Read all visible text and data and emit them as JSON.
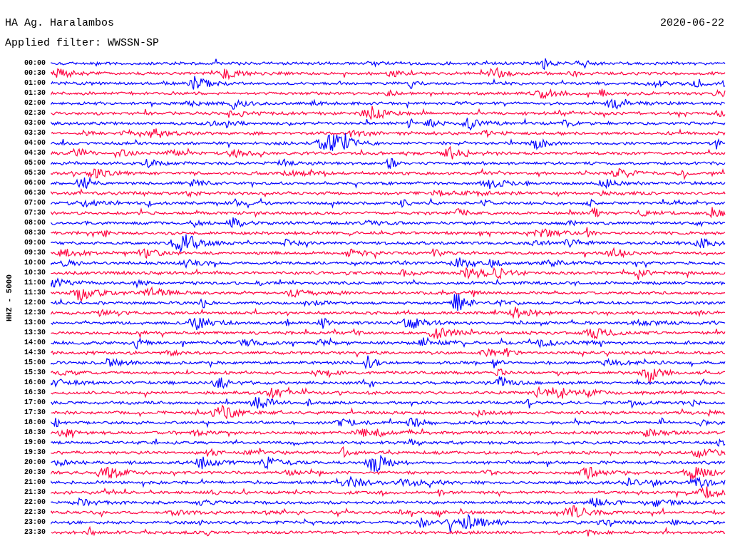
{
  "station": "HA Ag. Haralambos",
  "date": "2020-06-22",
  "filter": "Applied filter: WWSSN-SP",
  "axis_label": "HHZ - 5000",
  "traces": [
    {
      "time": "00:00",
      "color": "#0000ff"
    },
    {
      "time": "00:30",
      "color": "#ff0040"
    },
    {
      "time": "01:00",
      "color": "#0000ff"
    },
    {
      "time": "01:30",
      "color": "#ff0040"
    },
    {
      "time": "02:00",
      "color": "#0000ff"
    },
    {
      "time": "02:30",
      "color": "#ff0040"
    },
    {
      "time": "03:00",
      "color": "#0000ff"
    },
    {
      "time": "03:30",
      "color": "#ff0040"
    },
    {
      "time": "04:00",
      "color": "#0000ff"
    },
    {
      "time": "04:30",
      "color": "#ff0040"
    },
    {
      "time": "05:00",
      "color": "#0000ff"
    },
    {
      "time": "05:30",
      "color": "#ff0040"
    },
    {
      "time": "06:00",
      "color": "#0000ff"
    },
    {
      "time": "06:30",
      "color": "#ff0040"
    },
    {
      "time": "07:00",
      "color": "#0000ff"
    },
    {
      "time": "07:30",
      "color": "#ff0040"
    },
    {
      "time": "08:00",
      "color": "#0000ff"
    },
    {
      "time": "08:30",
      "color": "#ff0040"
    },
    {
      "time": "09:00",
      "color": "#0000ff"
    },
    {
      "time": "09:30",
      "color": "#ff0040"
    },
    {
      "time": "10:00",
      "color": "#0000ff"
    },
    {
      "time": "10:30",
      "color": "#ff0040"
    },
    {
      "time": "11:00",
      "color": "#0000ff"
    },
    {
      "time": "11:30",
      "color": "#ff0040"
    },
    {
      "time": "12:00",
      "color": "#0000ff"
    },
    {
      "time": "12:30",
      "color": "#ff0040"
    },
    {
      "time": "13:00",
      "color": "#0000ff"
    },
    {
      "time": "13:30",
      "color": "#ff0040"
    },
    {
      "time": "14:00",
      "color": "#0000ff"
    },
    {
      "time": "14:30",
      "color": "#ff0040"
    },
    {
      "time": "15:00",
      "color": "#0000ff"
    },
    {
      "time": "15:30",
      "color": "#ff0040"
    },
    {
      "time": "16:00",
      "color": "#0000ff"
    },
    {
      "time": "16:30",
      "color": "#ff0040"
    },
    {
      "time": "17:00",
      "color": "#0000ff"
    },
    {
      "time": "17:30",
      "color": "#ff0040"
    },
    {
      "time": "18:00",
      "color": "#0000ff"
    },
    {
      "time": "18:30",
      "color": "#ff0040"
    },
    {
      "time": "19:00",
      "color": "#0000ff"
    },
    {
      "time": "19:30",
      "color": "#ff0040"
    },
    {
      "time": "20:00",
      "color": "#0000ff"
    },
    {
      "time": "20:30",
      "color": "#ff0040"
    },
    {
      "time": "21:00",
      "color": "#0000ff"
    },
    {
      "time": "21:30",
      "color": "#ff0040"
    },
    {
      "time": "22:00",
      "color": "#0000ff"
    },
    {
      "time": "22:30",
      "color": "#ff0040"
    },
    {
      "time": "23:00",
      "color": "#0000ff"
    },
    {
      "time": "23:30",
      "color": "#ff0040"
    }
  ]
}
